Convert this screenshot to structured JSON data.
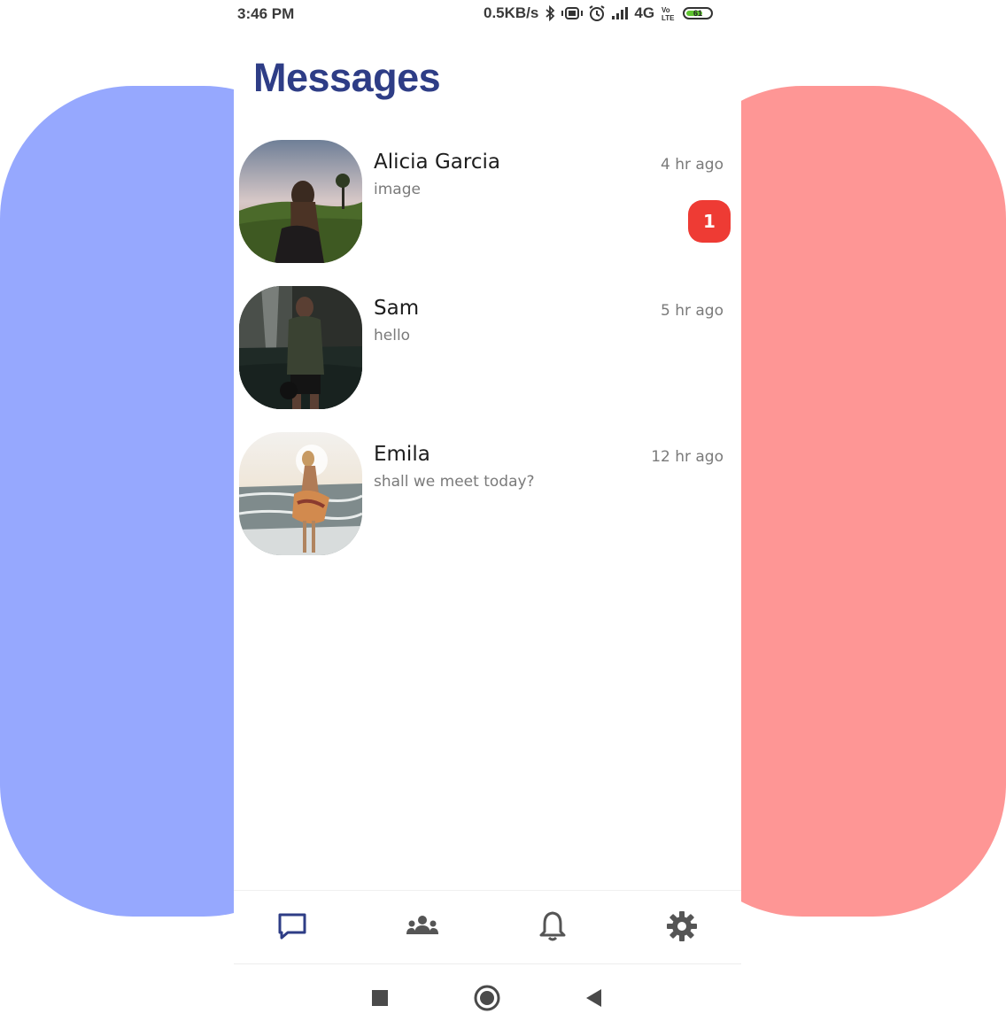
{
  "status_bar": {
    "time": "3:46 PM",
    "net_speed": "0.5KB/s",
    "network": "4G",
    "battery_level": "61",
    "icons": [
      "bluetooth-icon",
      "vibrate-icon",
      "alarm-icon",
      "signal-icon",
      "volte-icon",
      "battery-icon"
    ]
  },
  "header": {
    "title": "Messages"
  },
  "conversations": [
    {
      "name": "Alicia Garcia",
      "preview": "image",
      "time": "4 hr ago",
      "unread": "1"
    },
    {
      "name": "Sam",
      "preview": "hello",
      "time": "5 hr ago"
    },
    {
      "name": "Emila",
      "preview": "shall we meet today?",
      "time": "12 hr ago"
    }
  ],
  "bottom_nav": {
    "items": [
      "chat-icon",
      "group-icon",
      "bell-icon",
      "gear-icon"
    ],
    "active": "chat-icon",
    "active_color": "#2e3d86",
    "inactive_color": "#555555"
  },
  "system_nav": {
    "items": [
      "recents-square-icon",
      "home-circle-icon",
      "back-triangle-icon"
    ]
  },
  "colors": {
    "left_panel": "#96a8fe",
    "right_panel": "#fe9695",
    "badge": "#ee3b34",
    "title": "#2e3d86"
  }
}
